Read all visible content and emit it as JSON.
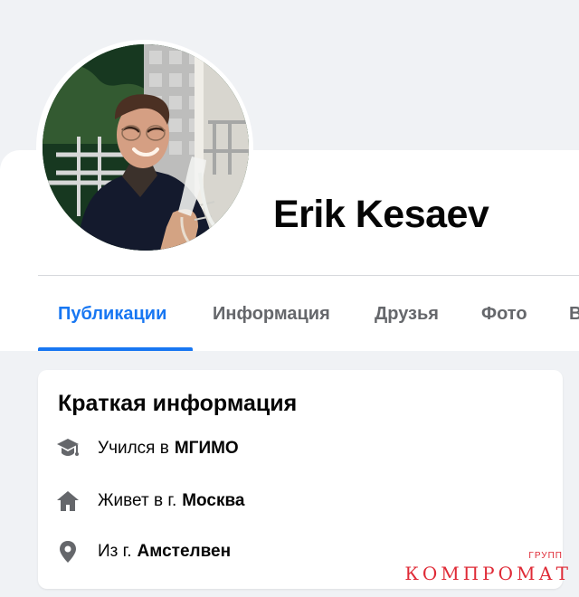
{
  "profile": {
    "name": "Erik Kesaev"
  },
  "tabs": [
    {
      "label": "Публикации",
      "active": true
    },
    {
      "label": "Информация",
      "active": false
    },
    {
      "label": "Друзья",
      "active": false
    },
    {
      "label": "Фото",
      "active": false
    },
    {
      "label": "В",
      "active": false
    }
  ],
  "intro": {
    "title": "Краткая информация",
    "items": [
      {
        "icon": "graduation-cap-icon",
        "prefix": "Учился в",
        "value": "МГИМО"
      },
      {
        "icon": "home-icon",
        "prefix": "Живет в г.",
        "value": "Москва"
      },
      {
        "icon": "location-pin-icon",
        "prefix": "Из г.",
        "value": "Амстелвен"
      }
    ]
  },
  "watermark": {
    "main": "КОМПРОМАТ",
    "small": "ГРУПП"
  },
  "colors": {
    "accent": "#1877f2",
    "page_background": "#f0f2f5",
    "card_background": "#ffffff",
    "secondary_text": "#65676b",
    "watermark": "#df2a36"
  }
}
